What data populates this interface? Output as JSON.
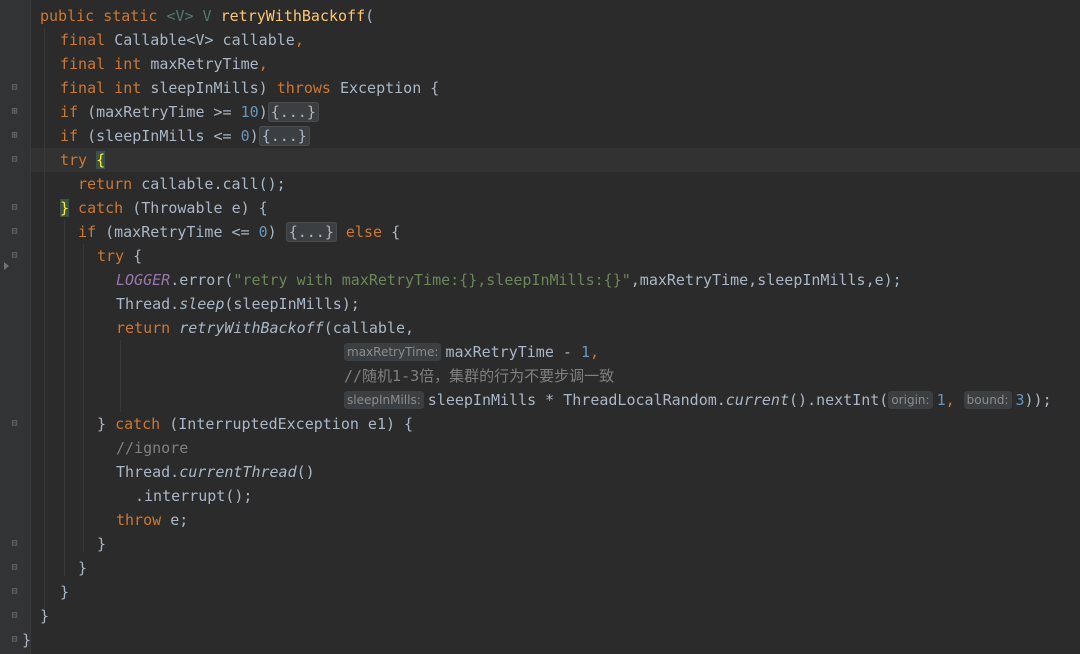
{
  "code": {
    "l1_kw": "public static ",
    "l1_generic": "<V>",
    "l1_type": " V ",
    "l1_method": "retryWithBackoff",
    "l1_paren": "(",
    "l2_kw": "final ",
    "l2_type": "Callable<V>",
    "l2_name": " callable",
    "l2_comma": ",",
    "l3_kw": "final int ",
    "l3_name": "maxRetryTime",
    "l3_comma": ",",
    "l4_kw": "final int ",
    "l4_name": "sleepInMills) ",
    "l4_throws": "throws",
    "l4_exc": " Exception {",
    "l5_kw": "if ",
    "l5_cond": "(maxRetryTime >= ",
    "l5_num": "10",
    "l5_close": ")",
    "l5_fold": "{...}",
    "l6_kw": "if ",
    "l6_cond": "(sleepInMills <= ",
    "l6_num": "0",
    "l6_close": ")",
    "l6_fold": "{...}",
    "l7_kw": "try ",
    "l7_brace": "{",
    "l8_kw": "return ",
    "l8_call": "callable.call();",
    "l9_brace": "}",
    "l9_kw": " catch ",
    "l9_args": "(Throwable e) {",
    "l10_kw": "if ",
    "l10_cond": "(maxRetryTime <= ",
    "l10_num": "0",
    "l10_close": ") ",
    "l10_fold": "{...}",
    "l10_else": " else ",
    "l10_brace": "{",
    "l11_kw": "try ",
    "l11_brace": "{",
    "l12_field": "LOGGER",
    "l12_call": ".error(",
    "l12_str": "\"retry with maxRetryTime:{},sleepInMills:{}\"",
    "l12_args": ",maxRetryTime,sleepInMills,e);",
    "l13_cls": "Thread.",
    "l13_method": "sleep",
    "l13_args": "(sleepInMills);",
    "l14_kw": "return ",
    "l14_method": "retryWithBackoff",
    "l14_args": "(callable,",
    "l15_hint": "maxRetryTime:",
    "l15_expr": "maxRetryTime - ",
    "l15_num": "1",
    "l15_comma": ",",
    "l16_comment": "//随机1-3倍，集群的行为不要步调一致",
    "l17_hint": "sleepInMills:",
    "l17_expr": "sleepInMills * ThreadLocalRandom.",
    "l17_method": "current",
    "l17_paren": "()",
    "l17_next": ".nextInt(",
    "l17_hint_origin": "origin:",
    "l17_num1": "1",
    "l17_comma": ", ",
    "l17_hint_bound": "bound:",
    "l17_num2": "3",
    "l17_end": "));",
    "l18_brace": "} ",
    "l18_kw": "catch ",
    "l18_args": "(InterruptedException e1) {",
    "l19_comment": "//ignore",
    "l20_cls": "Thread.",
    "l20_method": "currentThread",
    "l20_paren": "()",
    "l21_call": ".interrupt",
    "l21_end": "();",
    "l22_kw": "throw ",
    "l22_name": "e;",
    "l23_brace": "}",
    "l24_brace": "}",
    "l25_brace": "}",
    "l26_brace": "}",
    "l27_brace": "}"
  },
  "colors": {
    "background": "#2b2b2b",
    "keyword": "#cc7832",
    "number": "#6897bb",
    "string": "#6a8759",
    "method": "#ffc66d",
    "field": "#9876aa",
    "comment": "#808080",
    "text": "#a9b7c6"
  },
  "gutter": {
    "fold_icon": "fold-marker-icon"
  }
}
